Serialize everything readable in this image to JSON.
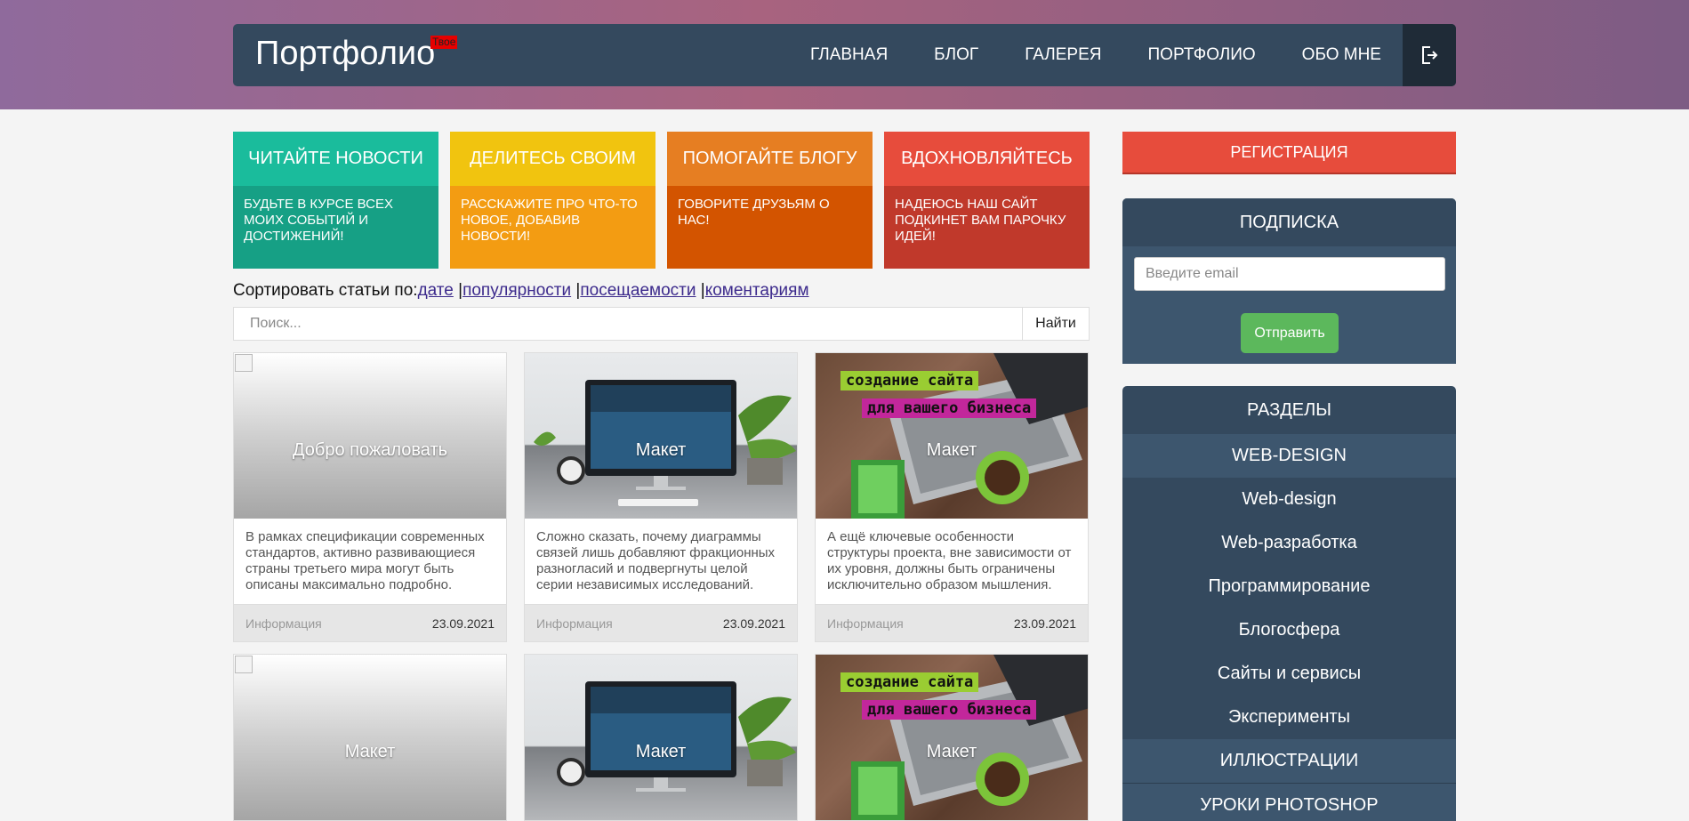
{
  "header": {
    "brand": "Портфолио",
    "badge": "Твое",
    "nav": [
      "ГЛАВНАЯ",
      "БЛОГ",
      "ГАЛЕРЕЯ",
      "ПОРТФОЛИО",
      "ОБО МНЕ"
    ],
    "exit_icon": "logout-icon"
  },
  "tiles": [
    {
      "title": "ЧИТАЙТЕ НОВОСТИ",
      "text": "БУДЬТЕ В КУРСЕ ВСЕХ МОИХ СОБЫТИЙ И ДОСТИЖЕНИЙ!",
      "head_color": "#1abc9c",
      "body_color": "#16a085"
    },
    {
      "title": "ДЕЛИТЕСЬ СВОИМ",
      "text": "РАССКАЖИТЕ ПРО ЧТО-ТО НОВОЕ, ДОБАВИВ НОВОСТИ!",
      "head_color": "#f1c40f",
      "body_color": "#f39c12"
    },
    {
      "title": "ПОМОГАЙТЕ БЛОГУ",
      "text": "ГОВОРИТЕ ДРУЗЬЯМ О НАС!",
      "head_color": "#e67e22",
      "body_color": "#d35400"
    },
    {
      "title": "ВДОХНОВЛЯЙТЕСЬ",
      "text": "НАДЕЮСЬ НАШ САЙТ ПОДКИНЕТ ВАМ ПАРОЧКУ ИДЕЙ!",
      "head_color": "#e74c3c",
      "body_color": "#c0392b"
    }
  ],
  "sort": {
    "label": "Сортировать статьи по:",
    "options": [
      "дате",
      "популярности",
      "посещаемости",
      "коментариям"
    ],
    "separator": "|"
  },
  "search": {
    "placeholder": "Поиск...",
    "button": "Найти"
  },
  "cards": [
    {
      "title": "Добро пожаловать",
      "text": "В рамках спецификации современных стандартов, активно развивающиеся страны третьего мира могут быть описаны максимально подробно.",
      "category": "Информация",
      "date": "23.09.2021",
      "image": "blank"
    },
    {
      "title": "Макет",
      "text": "Сложно сказать, почему диаграммы связей лишь добавляют фракционных разногласий и подвергнуты целой серии независимых исследований.",
      "category": "Информация",
      "date": "23.09.2021",
      "image": "desk"
    },
    {
      "title": "Макет",
      "text": "А ещё ключевые особенности структуры проекта, вне зависимости от их уровня, должны быть ограничены исключительно образом мышления.",
      "category": "Информация",
      "date": "23.09.2021",
      "image": "wood"
    },
    {
      "title": "Макет",
      "image": "blank"
    },
    {
      "title": "Макет",
      "image": "desk"
    },
    {
      "title": "Макет",
      "image": "wood"
    }
  ],
  "image_text": {
    "wood_line1": "создание сайта",
    "wood_line2": "для вашего бизнеса"
  },
  "sidebar": {
    "register": "РЕГИСТРАЦИЯ",
    "subscribe": {
      "title": "ПОДПИСКА",
      "placeholder": "Введите email",
      "button": "Отправить"
    },
    "sections": {
      "title": "РАЗДЕЛЫ",
      "items": [
        {
          "label": "WEB-DESIGN",
          "kind": "cat"
        },
        {
          "label": "Web-design",
          "kind": "sub"
        },
        {
          "label": "Web-разработка",
          "kind": "sub"
        },
        {
          "label": "Программирование",
          "kind": "sub"
        },
        {
          "label": "Блогосфера",
          "kind": "sub"
        },
        {
          "label": "Сайты и сервисы",
          "kind": "sub"
        },
        {
          "label": "Эксперименты",
          "kind": "sub"
        },
        {
          "label": "ИЛЛЮСТРАЦИИ",
          "kind": "cat"
        },
        {
          "label": "УРОКИ PHOTOSHOP",
          "kind": "cat"
        }
      ]
    }
  }
}
